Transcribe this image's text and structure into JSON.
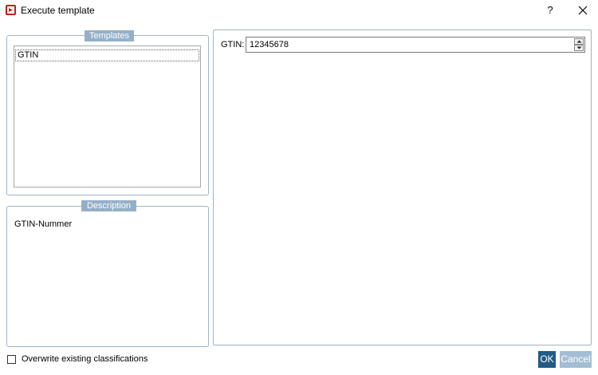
{
  "window": {
    "title": "Execute template",
    "help_label": "?",
    "icons": {
      "app": "app-logo-icon",
      "close": "close-icon"
    }
  },
  "templates": {
    "caption": "Templates",
    "items": [
      {
        "label": "GTIN",
        "selected": true
      }
    ]
  },
  "description": {
    "caption": "Description",
    "text": "GTIN-Nummer"
  },
  "parameters": {
    "gtin_label": "GTIN:",
    "gtin_value": "12345678"
  },
  "footer": {
    "overwrite_label": "Overwrite existing classifications",
    "overwrite_checked": false,
    "ok_label": "OK",
    "cancel_label": "Cancel"
  },
  "colors": {
    "accent": "#1f5b85",
    "caption_bg": "#94b0c8",
    "app_icon": "#c0201b"
  }
}
